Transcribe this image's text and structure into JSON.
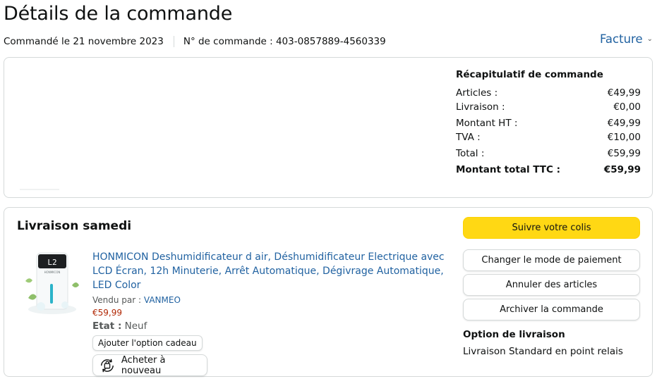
{
  "header": {
    "title": "Détails de la commande",
    "order_date": "Commandé le 21 novembre 2023",
    "order_number": "N° de commande : 403-0857889-4560339",
    "invoice_label": "Facture"
  },
  "summary": {
    "title": "Récapitulatif de commande",
    "rows": [
      {
        "label": "Articles :",
        "value": "€49,99"
      },
      {
        "label": "Livraison :",
        "value": "€0,00"
      },
      {
        "label": "Montant HT :",
        "value": "€49,99"
      },
      {
        "label": "TVA :",
        "value": "€10,00"
      },
      {
        "label": "Total :",
        "value": "€59,99"
      }
    ],
    "grand_total": {
      "label": "Montant total TTC :",
      "value": "€59,99"
    }
  },
  "delivery": {
    "title": "Livraison samedi",
    "product": {
      "title": "HONMICON Deshumidificateur d air, Déshumidificateur Electrique avec LCD Écran, 12h Minuterie, Arrêt Automatique, Dégivrage Automatique, LED Color",
      "sold_by_label": "Vendu par :",
      "seller": "VANMEO",
      "price": "€59,99",
      "condition_label": "Etat :",
      "condition_value": "Neuf",
      "screen_text": "L2",
      "brand_text": "HONMICON"
    },
    "gift_button": "Ajouter l'option cadeau",
    "rebuy_button": "Acheter à nouveau",
    "actions": {
      "track": "Suivre votre colis",
      "change_payment": "Changer le mode de paiement",
      "cancel": "Annuler des articles",
      "archive": "Archiver la commande"
    },
    "shipping_option_title": "Option de livraison",
    "shipping_option_value": "Livraison Standard en point relais"
  },
  "colors": {
    "link": "#2162a1",
    "price": "#b12704",
    "primary_button": "#ffd814",
    "border": "#d5d9d9"
  }
}
